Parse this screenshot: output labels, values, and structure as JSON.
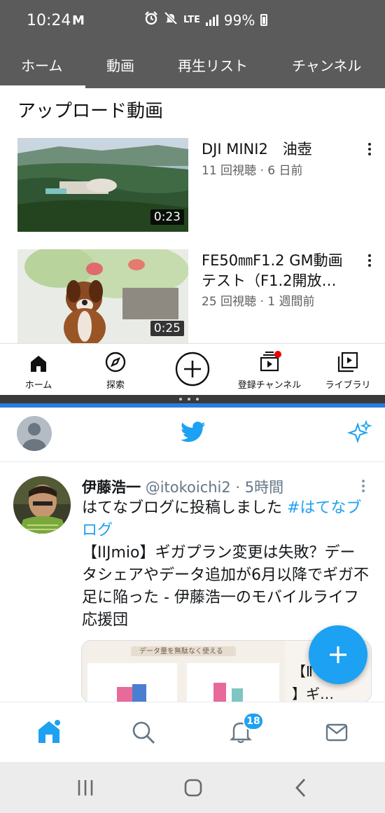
{
  "status_bar": {
    "time": "10:24",
    "mail_glyph": "M",
    "network": "LTE",
    "battery": "99%"
  },
  "youtube": {
    "tabs": [
      {
        "label": "ホーム",
        "active": true
      },
      {
        "label": "動画"
      },
      {
        "label": "再生リスト"
      },
      {
        "label": "チャンネル"
      }
    ],
    "section_title": "アップロード動画",
    "videos": [
      {
        "title": "DJI MINI2　油壺",
        "meta": "11 回視聴 · 6 日前",
        "duration": "0:23"
      },
      {
        "title": "FE50㎜F1.2 GM動画テスト（F1.2開放…",
        "meta": "25 回視聴 · 1 週間前",
        "duration": "0:25"
      }
    ],
    "bottom_nav": [
      {
        "label": "ホーム",
        "icon": "home-icon"
      },
      {
        "label": "探索",
        "icon": "compass-icon"
      },
      {
        "label": "",
        "icon": "create-icon"
      },
      {
        "label": "登録チャンネル",
        "icon": "subscriptions-icon"
      },
      {
        "label": "ライブラリ",
        "icon": "library-icon"
      }
    ]
  },
  "twitter": {
    "tweet": {
      "name": "伊藤浩一",
      "handle": "@itokoichi2 · 5時間",
      "text_line1": "はてなブログに投稿しました ",
      "hashtag": "#はてなブログ",
      "body": "【IIJmio】ギガプラン変更は失敗？データシェアやデータ追加が6月以降でギガ不足に陥った - 伊藤浩一のモバイルライフ応援団",
      "card_image_caption": "データ量を無駄なく使える",
      "card_text_partial": "【Ⅱ\n】ギ…"
    },
    "bottom_nav": [
      {
        "icon": "home-icon"
      },
      {
        "icon": "search-icon"
      },
      {
        "icon": "notifications-icon",
        "badge": "18"
      },
      {
        "icon": "messages-icon"
      }
    ],
    "colors": {
      "accent": "#1da1f2"
    }
  },
  "android_nav": [
    "recents-icon",
    "home-icon",
    "back-icon"
  ]
}
